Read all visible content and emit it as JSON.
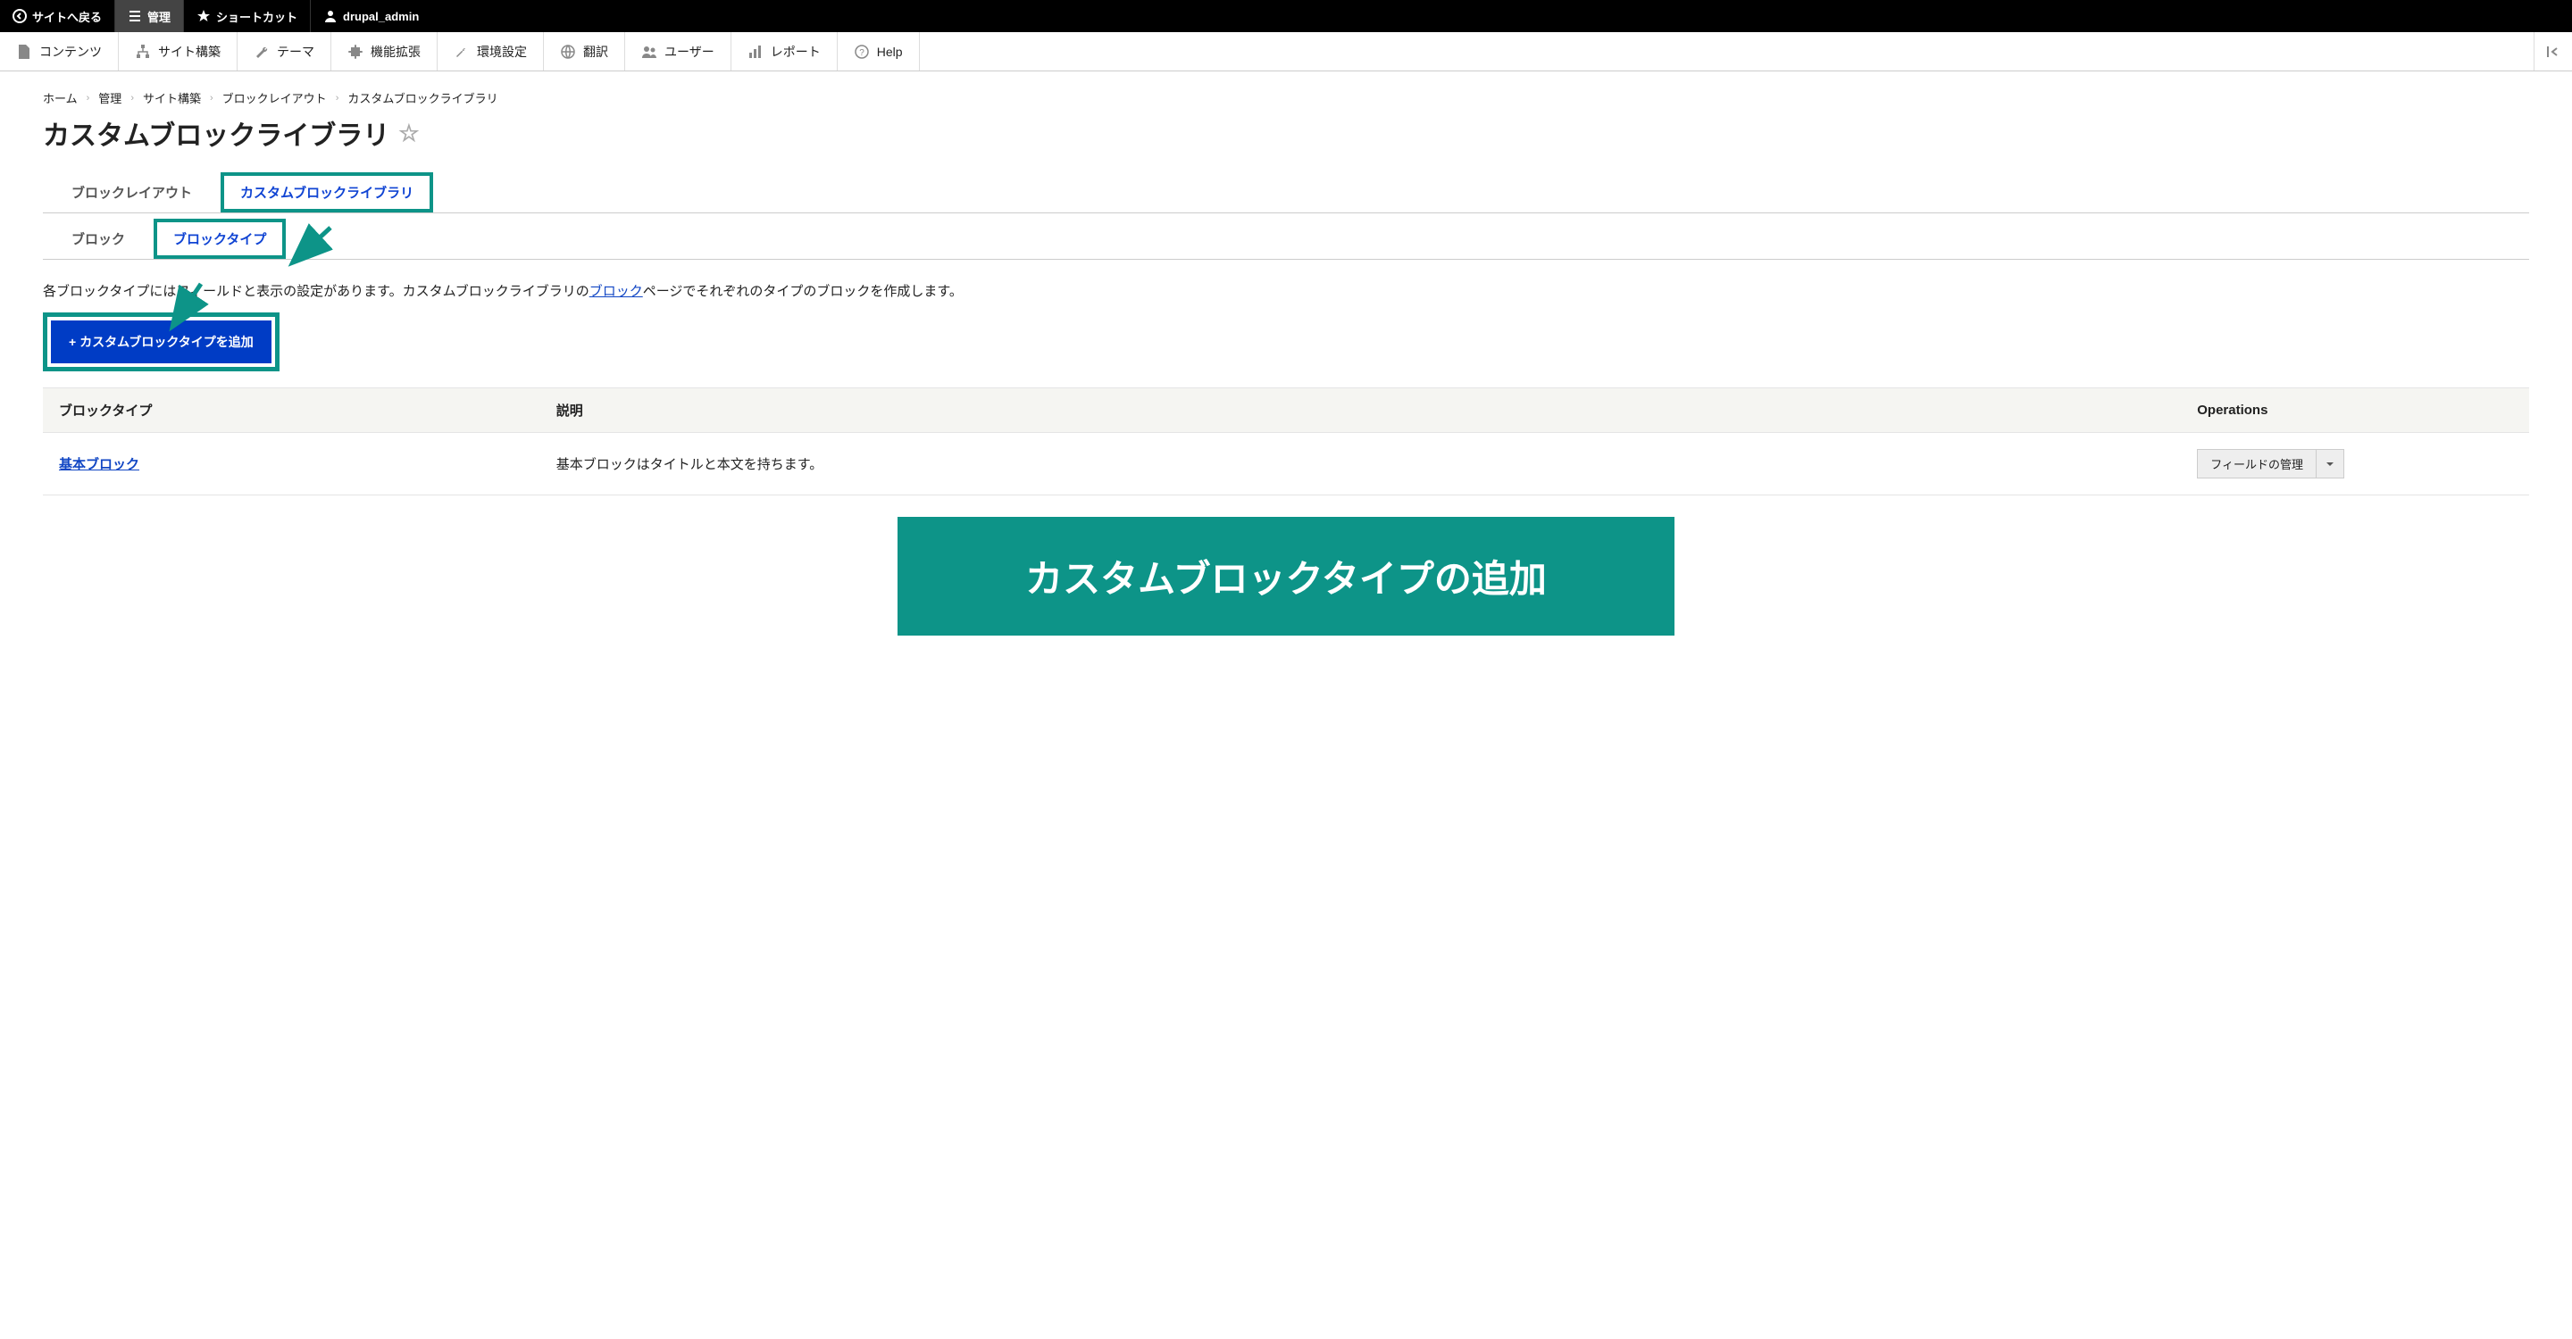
{
  "toolbar": {
    "back": "サイトへ戻る",
    "manage": "管理",
    "shortcuts": "ショートカット",
    "user": "drupal_admin"
  },
  "admin_menu": {
    "content": "コンテンツ",
    "structure": "サイト構築",
    "appearance": "テーマ",
    "extend": "機能拡張",
    "config": "環境設定",
    "translate": "翻訳",
    "people": "ユーザー",
    "reports": "レポート",
    "help": "Help"
  },
  "breadcrumb": {
    "home": "ホーム",
    "admin": "管理",
    "structure": "サイト構築",
    "block_layout": "ブロックレイアウト",
    "current": "カスタムブロックライブラリ"
  },
  "page": {
    "title": "カスタムブロックライブラリ"
  },
  "primary_tabs": {
    "layout": "ブロックレイアウト",
    "library": "カスタムブロックライブラリ"
  },
  "secondary_tabs": {
    "block": "ブロック",
    "type": "ブロックタイプ"
  },
  "description": {
    "pre": "各ブロックタイプにはフィールドと表示の設定があります。カスタムブロックライブラリの",
    "link": "ブロック",
    "post": "ページでそれぞれのタイプのブロックを作成します。"
  },
  "buttons": {
    "add": "カスタムブロックタイプを追加"
  },
  "table": {
    "th_type": "ブロックタイプ",
    "th_desc": "説明",
    "th_ops": "Operations",
    "row_name": "基本ブロック",
    "row_desc": "基本ブロックはタイトルと本文を持ちます。",
    "op_label": "フィールドの管理"
  },
  "banner": {
    "text": "カスタムブロックタイプの追加"
  }
}
